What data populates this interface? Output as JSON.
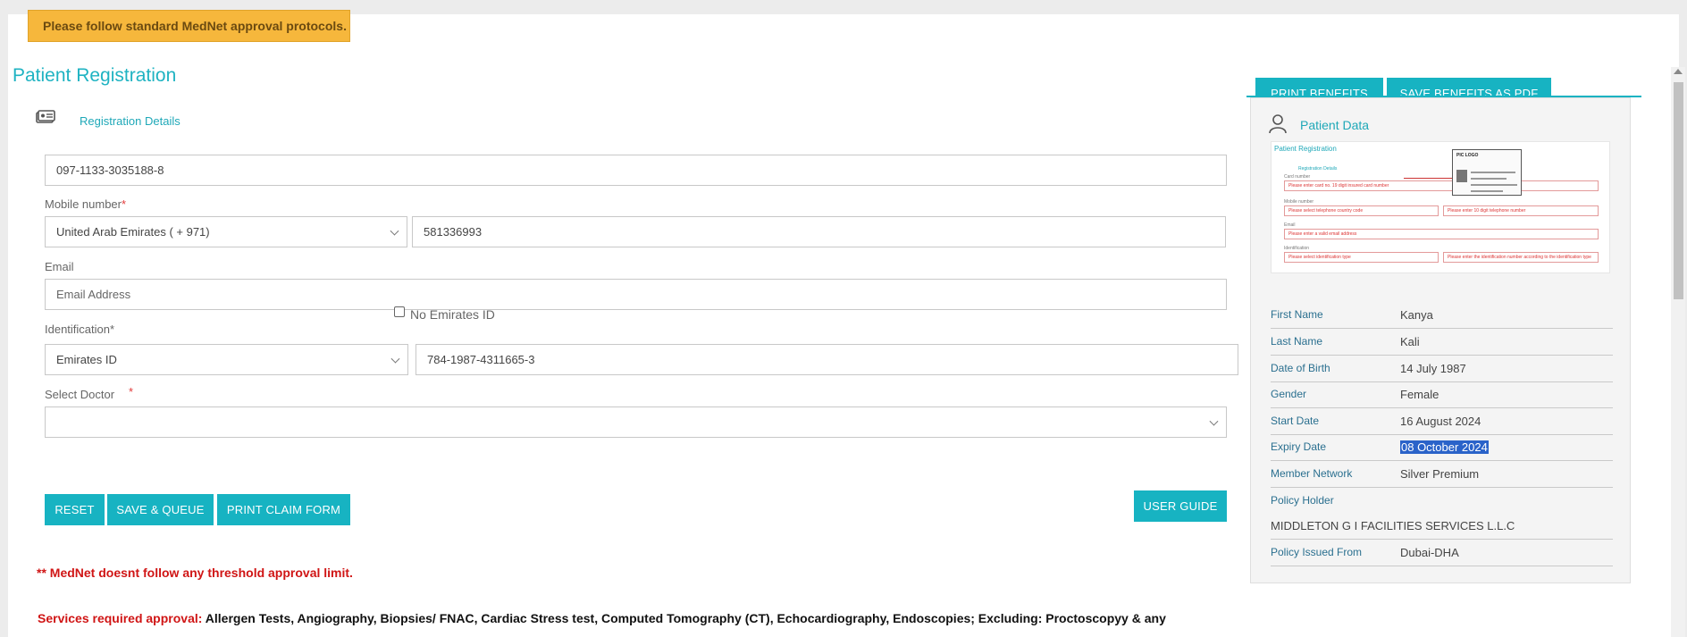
{
  "alert": "Please follow standard MedNet approval protocols.",
  "page_title": "Patient Registration",
  "registration": {
    "section_label": "Registration Details",
    "card_number_value": "097-1133-3035188-8",
    "mobile_label": "Mobile number",
    "required_mark": "*",
    "country_value": "United Arab Emirates ( + 971)",
    "mobile_value": "581336993",
    "email_label": "Email",
    "email_placeholder": "Email Address",
    "identification_label": "Identification*",
    "no_emirates_id_label": "No Emirates ID",
    "id_type_value": "Emirates ID",
    "id_number_value": "784-1987-4311665-3",
    "doctor_label": "Select Doctor",
    "doctor_value": ""
  },
  "buttons": {
    "reset": "RESET",
    "save_queue": "SAVE & QUEUE",
    "print_claim": "PRINT CLAIM FORM",
    "user_guide": "USER GUIDE",
    "print_benefits": "PRINT BENEFITS",
    "save_benefits_pdf": "SAVE BENEFITS AS PDF"
  },
  "notes": {
    "threshold": "** MedNet doesnt follow any threshold approval limit.",
    "services_prefix": "Services required approval:",
    "services_list": " Allergen Tests, Angiography, Biopsies/ FNAC, Cardiac Stress test, Computed Tomography (CT), Echocardiography, Endoscopies; Excluding: Proctoscopyy & any"
  },
  "patient_data": {
    "title": "Patient Data",
    "thumbnail": {
      "title": "Patient Registration",
      "section": "Registration Details",
      "card_number_label": "Card number",
      "card_hint": "Please enter card no. 19 digit insured card number",
      "mobile_label": "Mobile number",
      "country_hint": "Please select telephone country code",
      "mobile_hint": "Please enter 10 digit telephone number",
      "email_label": "Email",
      "email_hint": "Please enter a valid email address",
      "id_label": "Identification",
      "id_type_hint": "Please select identification type",
      "id_number_hint": "Please enter the identification number according to the identification type",
      "card_heading": "PIC LOGO"
    },
    "fields": [
      {
        "label": "First Name",
        "value": "Kanya"
      },
      {
        "label": "Last Name",
        "value": "Kali"
      },
      {
        "label": "Date of Birth",
        "value": "14 July 1987"
      },
      {
        "label": "Gender",
        "value": "Female"
      },
      {
        "label": "Start Date",
        "value": "16 August 2024"
      },
      {
        "label": "Expiry Date",
        "value": "08 October 2024"
      },
      {
        "label": "Member Network",
        "value": "Silver Premium"
      }
    ],
    "policy_holder_label": "Policy Holder",
    "policy_holder_value": "MIDDLETON G I FACILITIES SERVICES L.L.C",
    "policy_issued_label": "Policy Issued From",
    "policy_issued_value": "Dubai-DHA"
  }
}
